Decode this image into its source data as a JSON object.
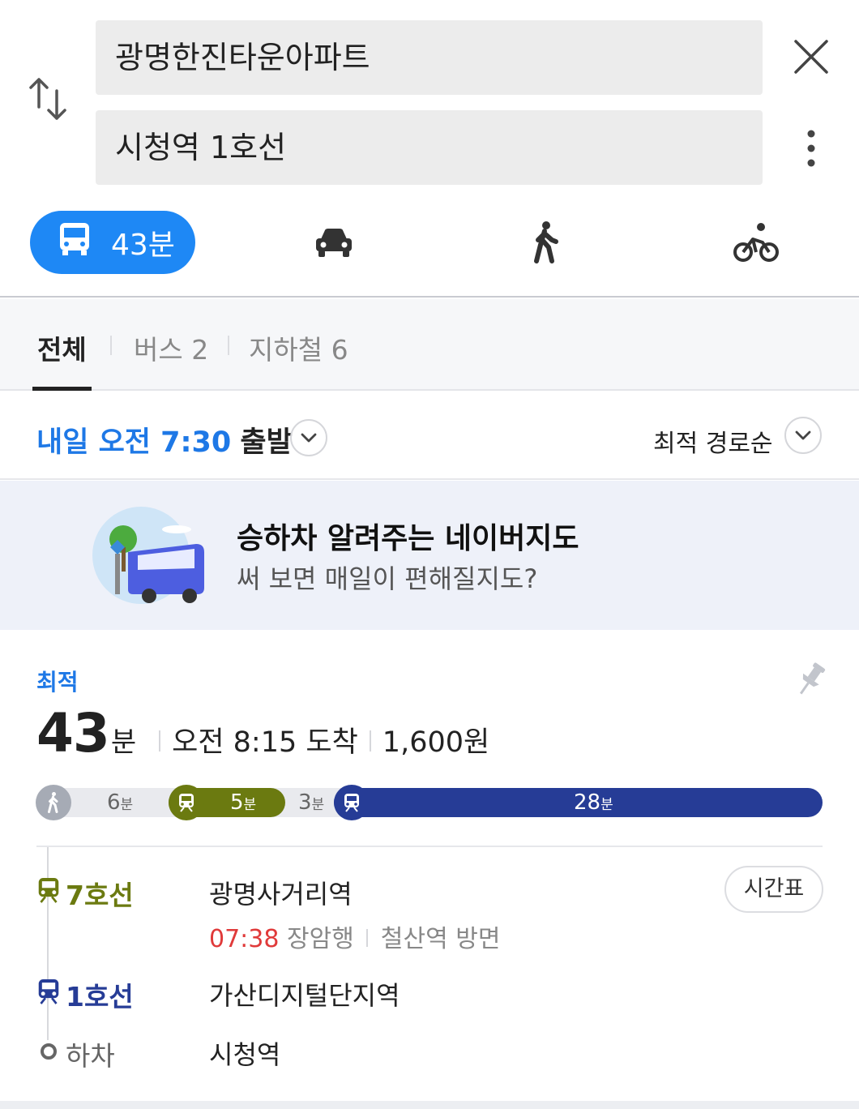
{
  "search": {
    "start": "광명한진타운아파트",
    "end": "시청역 1호선"
  },
  "modes": {
    "active_label": "43분",
    "items": [
      "bus-icon",
      "car-icon",
      "walk-icon",
      "bike-icon"
    ]
  },
  "filter_tabs": [
    {
      "label": "전체",
      "active": true
    },
    {
      "label": "버스 2",
      "active": false
    },
    {
      "label": "지하철 6",
      "active": false
    }
  ],
  "departure": {
    "highlight": "내일 오전 7:30",
    "suffix": "출발",
    "sort_label": "최적 경로순"
  },
  "banner": {
    "title": "승하차 알려주는 네이버지도",
    "subtitle": "써 보면 매일이 편해질지도?"
  },
  "route": {
    "badge": "최적",
    "minutes": "43",
    "minute_unit": "분",
    "arrival": "오전 8:15 도착",
    "fare": "1,600원",
    "segments": {
      "walk1": {
        "num": "6",
        "unit": "분"
      },
      "line7": {
        "num": "5",
        "unit": "분"
      },
      "walk2": {
        "num": "3",
        "unit": "분"
      },
      "line1": {
        "num": "28",
        "unit": "분"
      }
    },
    "steps": {
      "line7_label": "7호선",
      "line7_station": "광명사거리역",
      "line7_time": "07:38",
      "line7_dest": "장암행",
      "line7_direction": "철산역 방면",
      "timetable_label": "시간표",
      "line1_label": "1호선",
      "line1_station": "가산디지털단지역",
      "alight_label": "하차",
      "alight_station": "시청역"
    }
  },
  "colors": {
    "accent": "#1e88f5",
    "line7": "#6b7a10",
    "line1": "#263c96",
    "walk": "#9aa0aa",
    "red": "#e03a3a"
  }
}
